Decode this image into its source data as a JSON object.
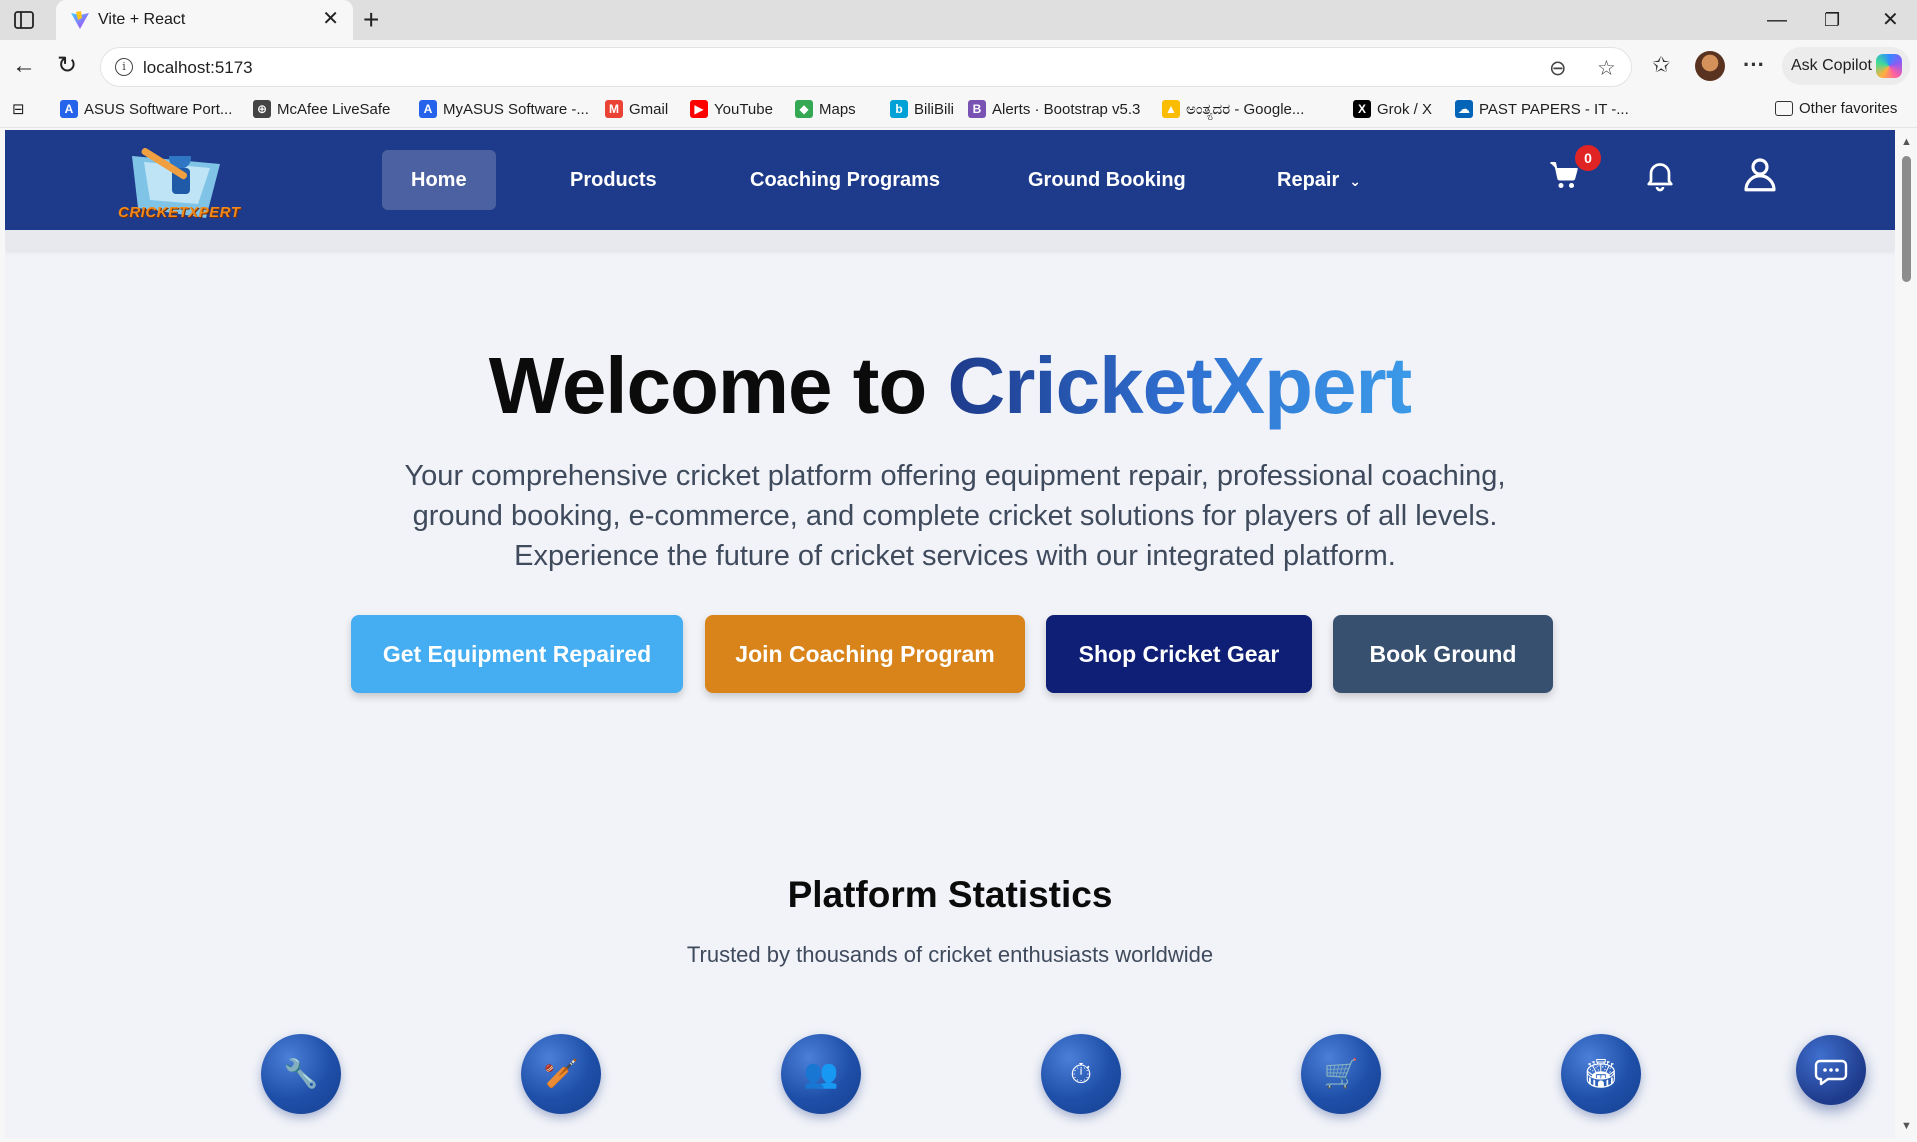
{
  "browser": {
    "tab_title": "Vite + React",
    "url": "localhost:5173",
    "copilot_label": "Ask Copilot",
    "bookmarks": [
      {
        "label": "ASUS Software Port...",
        "icon": "asus-icon",
        "color": "#2563eb"
      },
      {
        "label": "McAfee LiveSafe",
        "icon": "globe-icon",
        "color": "#444444"
      },
      {
        "label": "MyASUS Software -...",
        "icon": "asus-icon",
        "color": "#2563eb"
      },
      {
        "label": "Gmail",
        "icon": "gmail-icon",
        "color": "#ea4335"
      },
      {
        "label": "YouTube",
        "icon": "youtube-icon",
        "color": "#ff0000"
      },
      {
        "label": "Maps",
        "icon": "maps-icon",
        "color": "#34a853"
      },
      {
        "label": "BiliBili",
        "icon": "bilibili-icon",
        "color": "#00a1d6"
      },
      {
        "label": "Alerts · Bootstrap v5.3",
        "icon": "bootstrap-icon",
        "color": "#7952b3"
      },
      {
        "label": "ಅಂತ್ಯದರ - Google...",
        "icon": "google-drive-icon",
        "color": "#fbbc04"
      },
      {
        "label": "Grok / X",
        "icon": "x-icon",
        "color": "#000000"
      },
      {
        "label": "PAST PAPERS - IT -...",
        "icon": "onedrive-icon",
        "color": "#0364b8"
      }
    ],
    "other_favorites": "Other favorites"
  },
  "site": {
    "brand": "CRICKETXPERT",
    "nav": {
      "home": "Home",
      "products": "Products",
      "coaching": "Coaching Programs",
      "ground": "Ground Booking",
      "repair": "Repair"
    },
    "cart_count": "0"
  },
  "hero": {
    "title_prefix": "Welcome to ",
    "title_brand": "CricketXpert",
    "subtitle": "Your comprehensive cricket platform offering equipment repair, professional coaching, ground booking, e-commerce, and complete cricket solutions for players of all levels. Experience the future of cricket services with our integrated platform.",
    "buttons": {
      "repair": "Get Equipment Repaired",
      "coaching": "Join Coaching Program",
      "shop": "Shop Cricket Gear",
      "ground": "Book Ground"
    }
  },
  "stats": {
    "title": "Platform Statistics",
    "subtitle": "Trusted by thousands of cricket enthusiasts worldwide",
    "icons": [
      "wrench-icon",
      "cricket-bat-icon",
      "users-icon",
      "stopwatch-icon",
      "cart-icon",
      "stadium-icon"
    ]
  },
  "colors": {
    "nav_bg": "#1e3a8a",
    "btn_repair": "#45aef2",
    "btn_coaching": "#d9841a",
    "btn_shop": "#0f1f75",
    "btn_ground": "#37506f",
    "badge": "#e02424"
  }
}
